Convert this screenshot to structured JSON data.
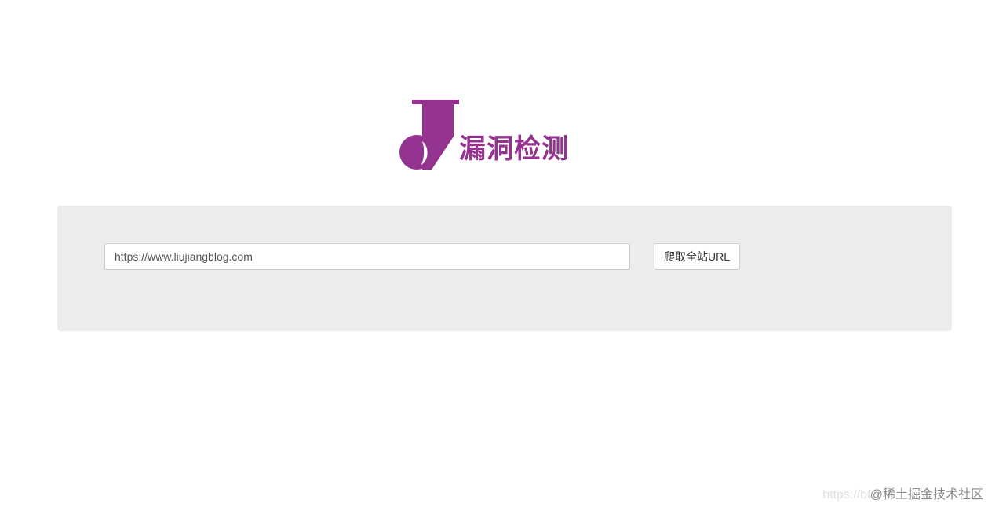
{
  "logo": {
    "icon": "j-logo-icon",
    "text": "漏洞检测",
    "color": "#93328f"
  },
  "search": {
    "value": "https://www.liujiangblog.com",
    "button_label": "爬取全站URL"
  },
  "watermark": {
    "url_text": "https://bl",
    "site_text": "@稀土掘金技术社区"
  }
}
